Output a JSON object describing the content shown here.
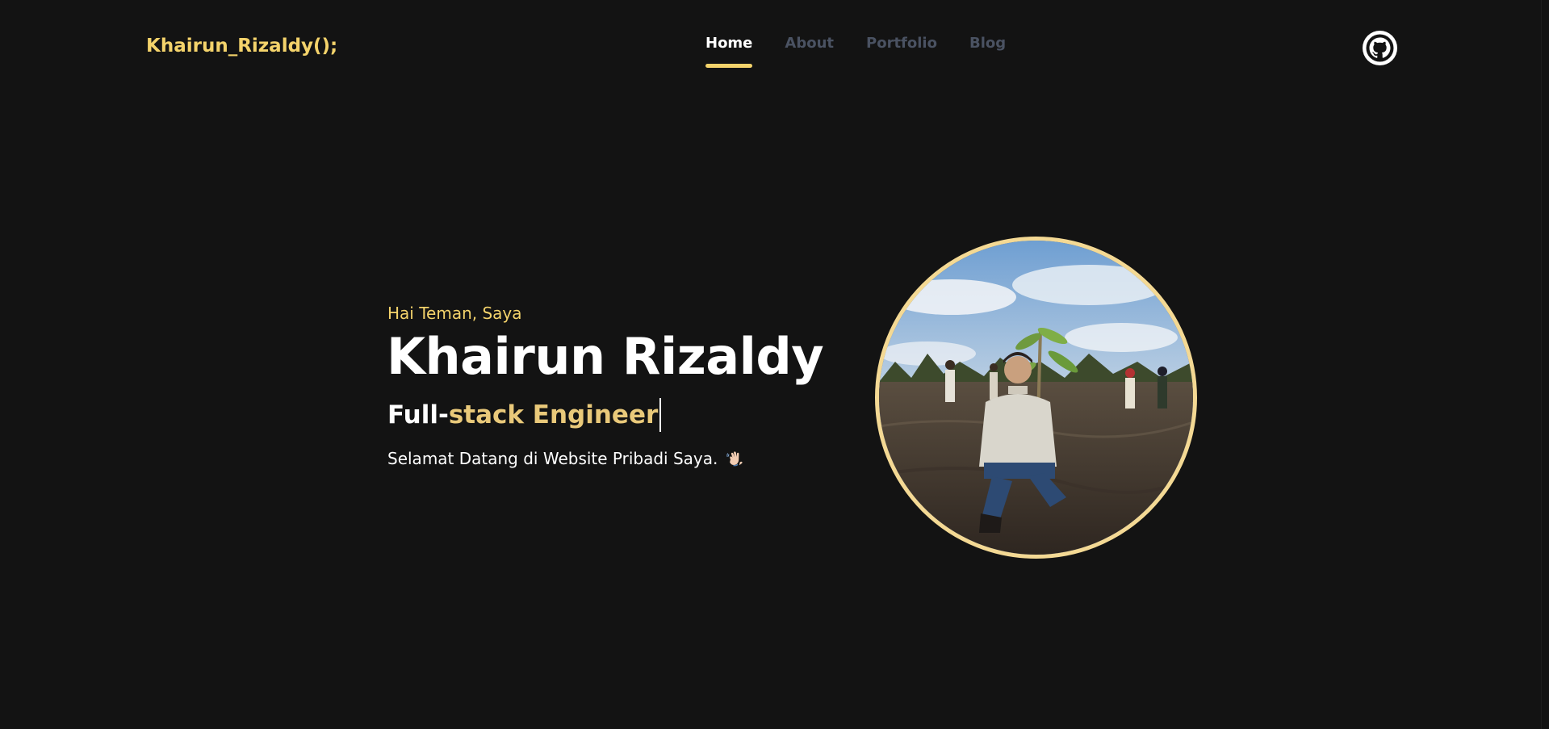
{
  "header": {
    "logo": "Khairun_Rizaldy();",
    "nav": [
      {
        "label": "Home",
        "active": true
      },
      {
        "label": "About",
        "active": false
      },
      {
        "label": "Portfolio",
        "active": false
      },
      {
        "label": "Blog",
        "active": false
      }
    ],
    "github_icon": "github-icon"
  },
  "hero": {
    "greeting": "Hai Teman, Saya",
    "name": "Khairun Rizaldy",
    "role_part1": "Full-",
    "role_part2": "stack Engineer",
    "welcome": "Selamat Datang di Website Pribadi Saya.",
    "wave_icon": "waving-hand-icon",
    "photo_icon": "profile-photo"
  },
  "colors": {
    "background": "#131313",
    "accent": "#f4d36b",
    "nav_inactive": "#4a5262",
    "role_accent": "#e9c97a"
  }
}
